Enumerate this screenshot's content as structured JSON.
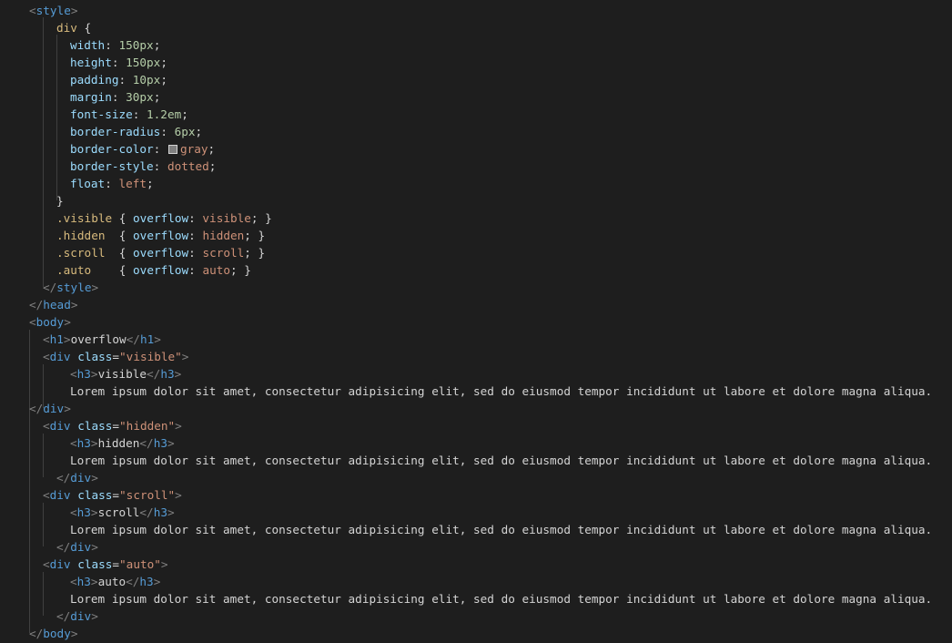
{
  "editor": {
    "css": {
      "style_open_tag": "style",
      "div_selector": "div",
      "props": {
        "width": {
          "name": "width",
          "value": "150px"
        },
        "height": {
          "name": "height",
          "value": "150px"
        },
        "padding": {
          "name": "padding",
          "value": "10px"
        },
        "margin": {
          "name": "margin",
          "value": "30px"
        },
        "font_size": {
          "name": "font-size",
          "value": "1.2em"
        },
        "border_radius": {
          "name": "border-radius",
          "value": "6px"
        },
        "border_color": {
          "name": "border-color",
          "value": "gray"
        },
        "border_style": {
          "name": "border-style",
          "value": "dotted"
        },
        "float": {
          "name": "float",
          "value": "left"
        }
      },
      "rules": {
        "visible": {
          "selector": ".visible",
          "prop": "overflow",
          "value": "visible"
        },
        "hidden": {
          "selector": ".hidden",
          "prop": "overflow",
          "value": "hidden"
        },
        "scroll": {
          "selector": ".scroll",
          "prop": "overflow",
          "value": "scroll"
        },
        "auto": {
          "selector": ".auto",
          "prop": "overflow",
          "value": "auto"
        }
      },
      "style_close_tag": "style",
      "head_close_tag": "head"
    },
    "html": {
      "body_open_tag": "body",
      "h1_tag": "h1",
      "h1_text": "overflow",
      "div_tag": "div",
      "class_attr": "class",
      "h3_tag": "h3",
      "lorem": "Lorem ipsum dolor sit amet, consectetur adipisicing elit, sed do eiusmod tempor incididunt ut labore et dolore magna aliqua.",
      "blocks": {
        "visible": {
          "class_value": "\"visible\"",
          "h3_text": "visible"
        },
        "hidden": {
          "class_value": "\"hidden\"",
          "h3_text": "hidden"
        },
        "scroll": {
          "class_value": "\"scroll\"",
          "h3_text": "scroll"
        },
        "auto": {
          "class_value": "\"auto\"",
          "h3_text": "auto"
        }
      },
      "body_close_tag": "body"
    },
    "colors": {
      "background": "#1e1e1e",
      "tag": "#569cd6",
      "bracket": "#808080",
      "attribute": "#9cdcfe",
      "string": "#ce9178",
      "number": "#b5cea8",
      "selector": "#d7ba7d",
      "text": "#d4d4d4",
      "swatch": "#808080"
    }
  }
}
